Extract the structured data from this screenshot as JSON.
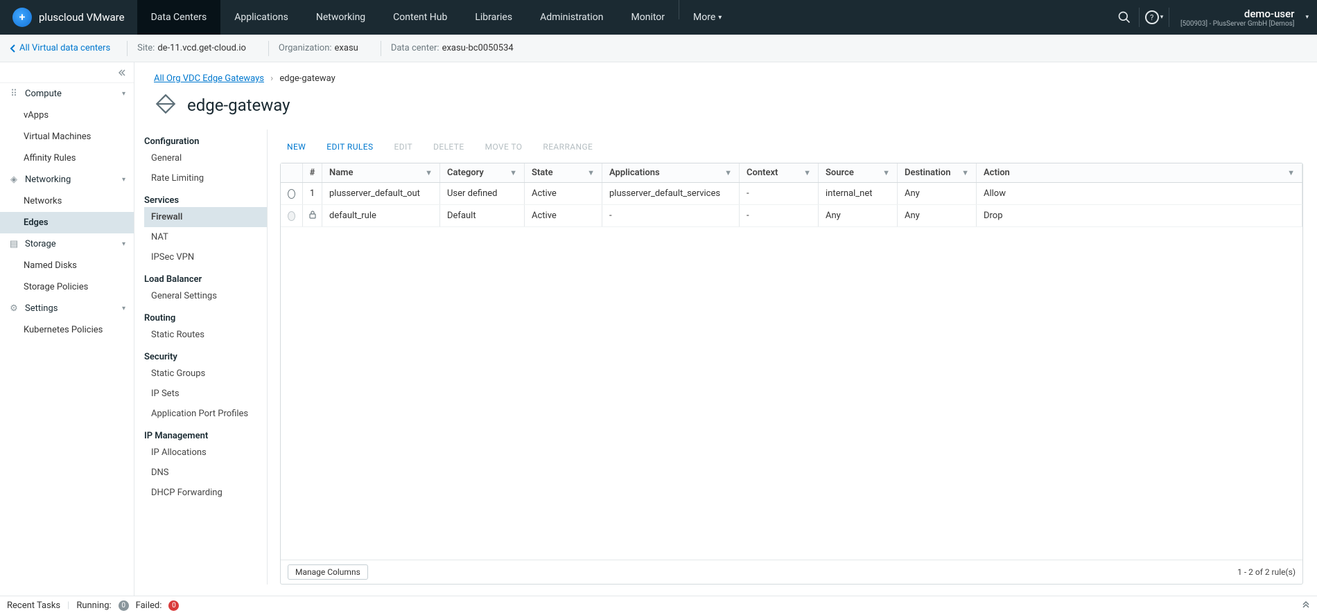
{
  "brand": "pluscloud VMware",
  "topnav": {
    "tabs": [
      "Data Centers",
      "Applications",
      "Networking",
      "Content Hub",
      "Libraries",
      "Administration",
      "Monitor"
    ],
    "more": "More"
  },
  "user": {
    "name": "demo-user",
    "org": "[500903] - PlusServer GmbH [Demos]"
  },
  "context": {
    "back": "All Virtual data centers",
    "site_label": "Site:",
    "site": "de-11.vcd.get-cloud.io",
    "org_label": "Organization:",
    "org": "exasu",
    "dc_label": "Data center:",
    "dc": "exasu-bc0050534"
  },
  "leftnav": {
    "groups": [
      {
        "name": "Compute",
        "icon": "⠿",
        "items": [
          "vApps",
          "Virtual Machines",
          "Affinity Rules"
        ]
      },
      {
        "name": "Networking",
        "icon": "◈",
        "items": [
          "Networks",
          "Edges"
        ],
        "selected": "Edges"
      },
      {
        "name": "Storage",
        "icon": "▤",
        "items": [
          "Named Disks",
          "Storage Policies"
        ]
      },
      {
        "name": "Settings",
        "icon": "⚙",
        "items": [
          "Kubernetes Policies"
        ]
      }
    ]
  },
  "breadcrumb": {
    "root": "All Org VDC Edge Gateways",
    "leaf": "edge-gateway"
  },
  "page_title": "edge-gateway",
  "inner_nav": [
    {
      "group": "Configuration",
      "items": [
        "General",
        "Rate Limiting"
      ]
    },
    {
      "group": "Services",
      "items": [
        "Firewall",
        "NAT",
        "IPSec VPN"
      ],
      "selected": "Firewall"
    },
    {
      "group": "Load Balancer",
      "items": [
        "General Settings"
      ]
    },
    {
      "group": "Routing",
      "items": [
        "Static Routes"
      ]
    },
    {
      "group": "Security",
      "items": [
        "Static Groups",
        "IP Sets",
        "Application Port Profiles"
      ]
    },
    {
      "group": "IP Management",
      "items": [
        "IP Allocations",
        "DNS",
        "DHCP Forwarding"
      ]
    }
  ],
  "toolbar": {
    "new": "New",
    "edit_rules": "Edit Rules",
    "edit": "Edit",
    "delete": "Delete",
    "move_to": "Move to",
    "rearrange": "Rearrange"
  },
  "columns": [
    "#",
    "Name",
    "Category",
    "State",
    "Applications",
    "Context",
    "Source",
    "Destination",
    "Action"
  ],
  "rows": [
    {
      "radio": "enabled",
      "num": "1",
      "name": "plusserver_default_out",
      "category": "User defined",
      "state": "Active",
      "apps": "plusserver_default_services",
      "context": "-",
      "source": "internal_net",
      "destination": "Any",
      "action": "Allow"
    },
    {
      "radio": "locked",
      "num": "",
      "name": "default_rule",
      "category": "Default",
      "state": "Active",
      "apps": "-",
      "context": "-",
      "source": "Any",
      "destination": "Any",
      "action": "Drop"
    }
  ],
  "footer_table": {
    "manage": "Manage Columns",
    "count": "1 - 2 of 2 rule(s)"
  },
  "footer": {
    "recent": "Recent Tasks",
    "running_label": "Running:",
    "running": "0",
    "failed_label": "Failed:",
    "failed": "0"
  }
}
